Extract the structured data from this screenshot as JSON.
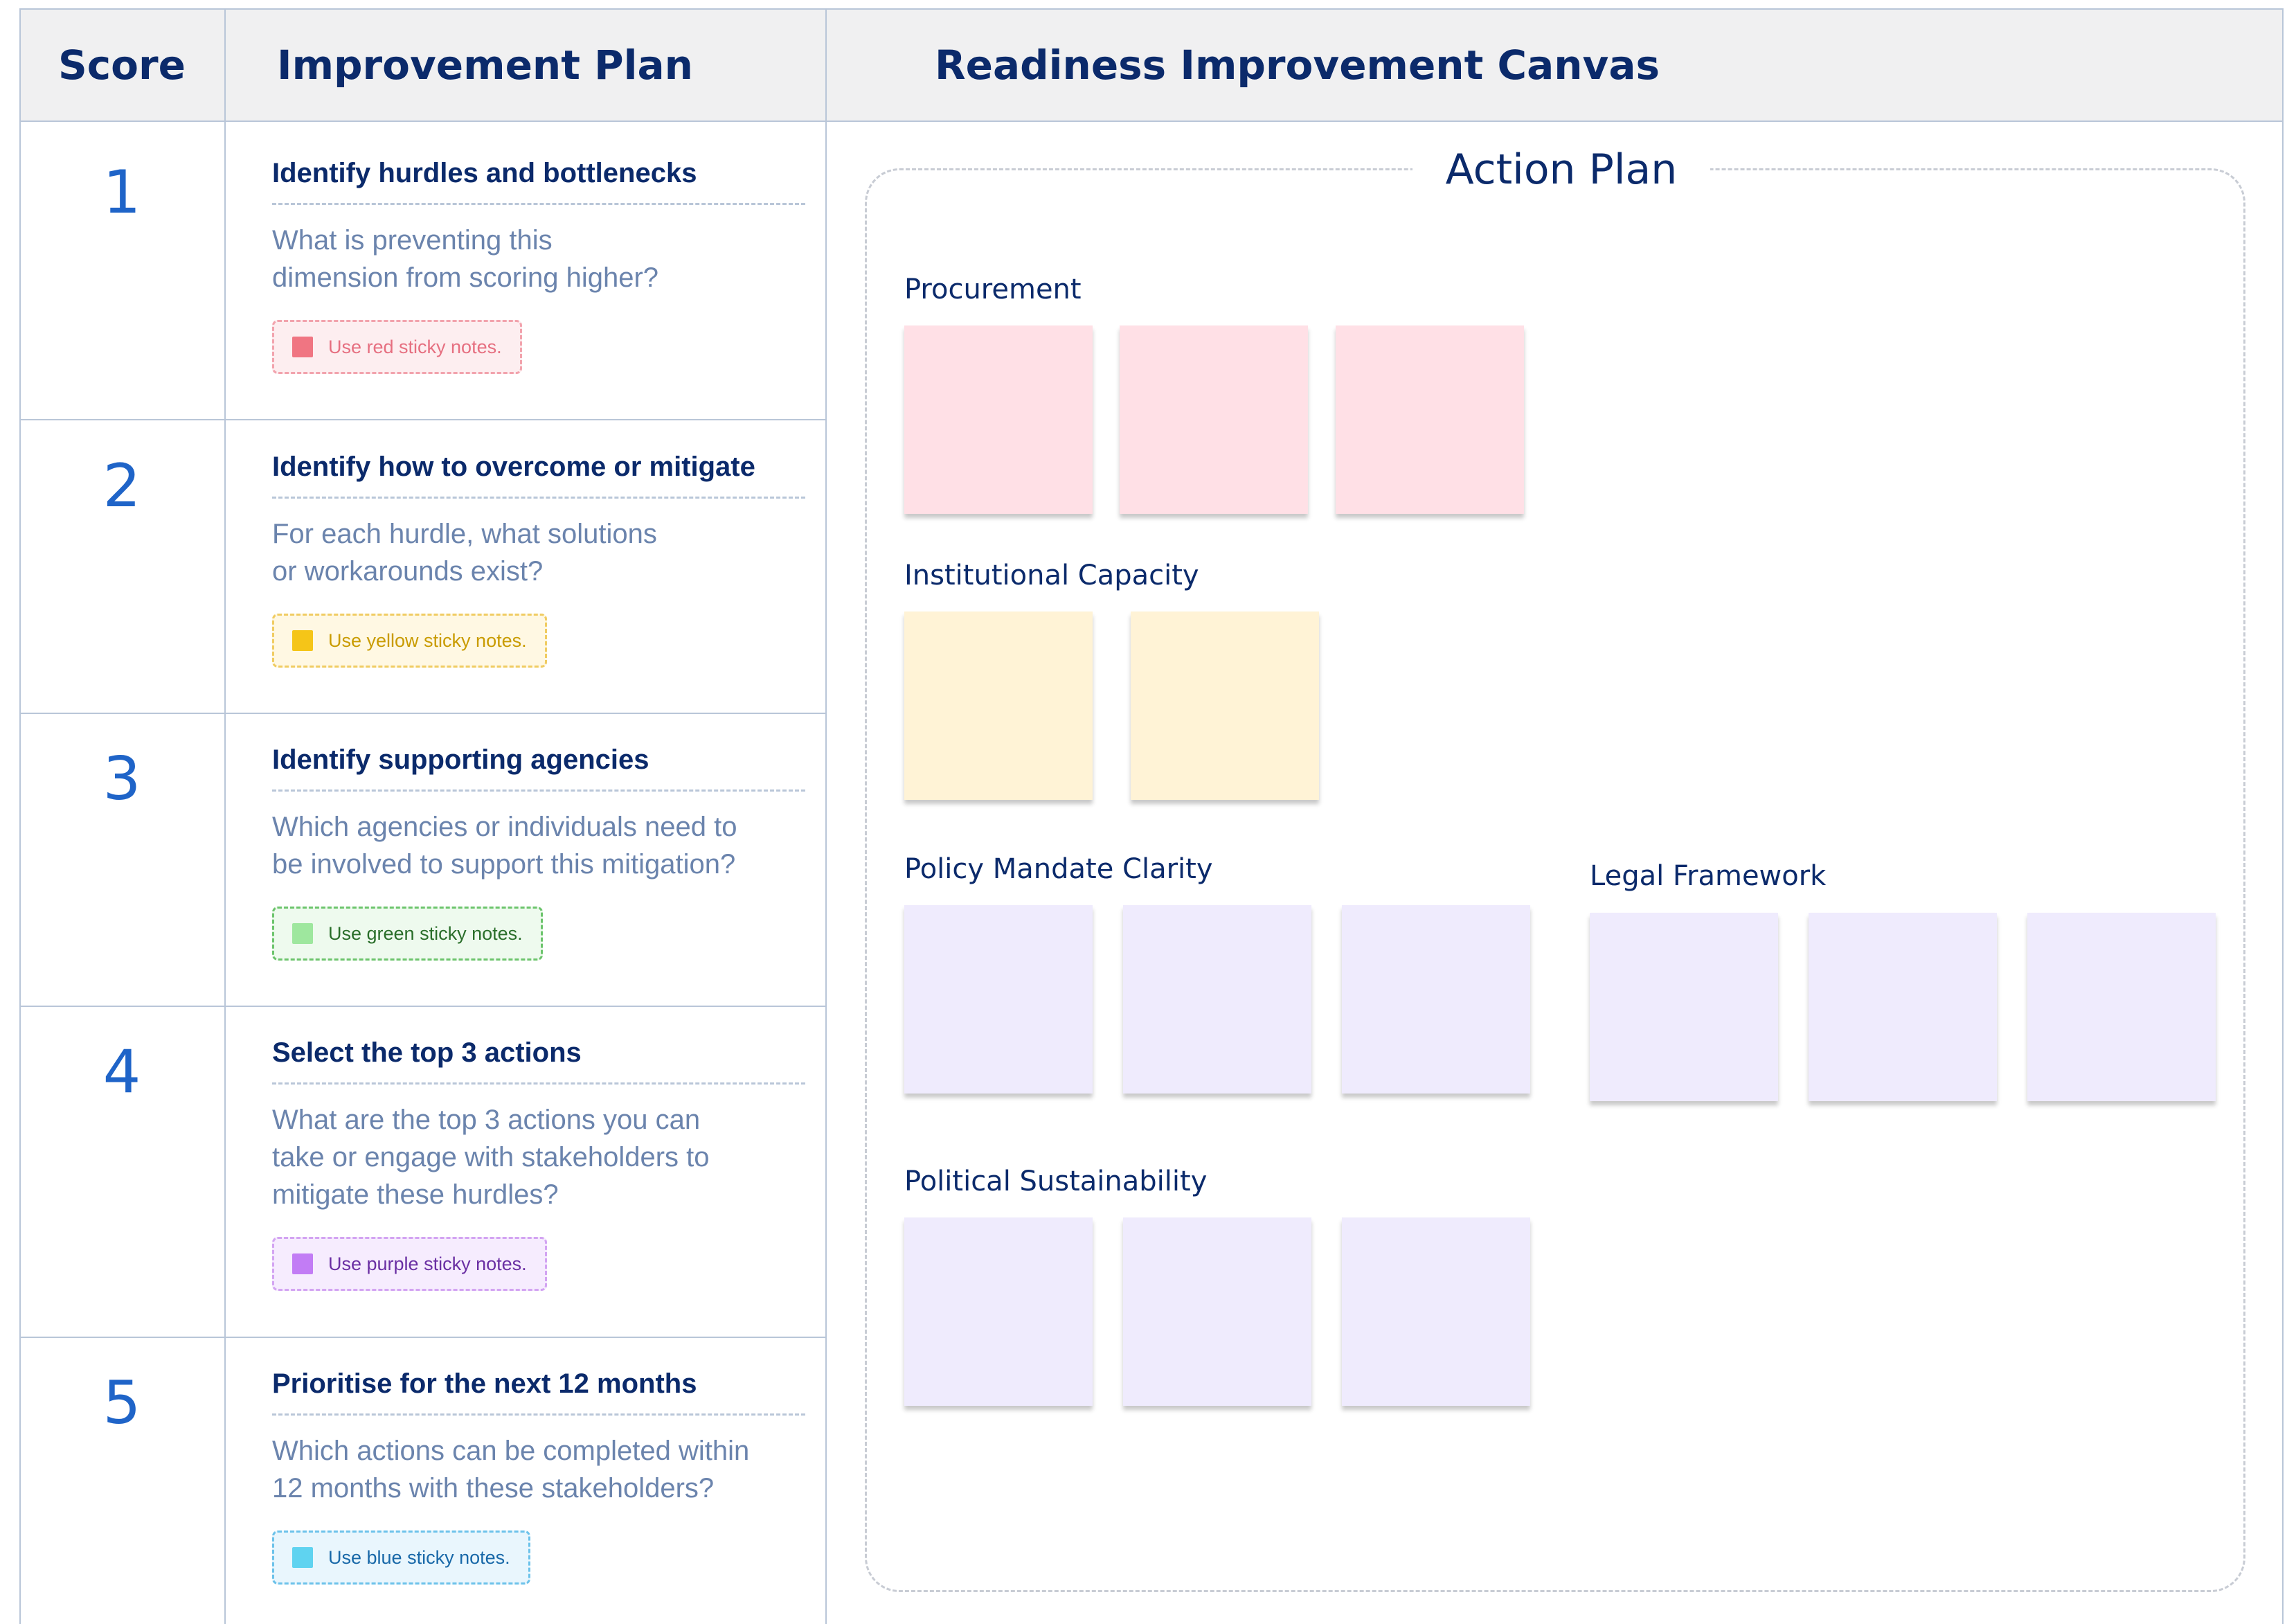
{
  "headers": {
    "score": "Score",
    "improvement_plan": "Improvement Plan",
    "canvas": "Readiness Improvement Canvas"
  },
  "steps": [
    {
      "score": "1",
      "title": "Identify hurdles and bottlenecks",
      "description": "What is preventing this\ndimension from scoring higher?",
      "hint": "Use red sticky notes.",
      "hint_color": "#f07582"
    },
    {
      "score": "2",
      "title": "Identify how to overcome or mitigate",
      "description": "For each hurdle, what solutions\nor workarounds exist?",
      "hint": "Use yellow sticky notes.",
      "hint_color": "#f5c518"
    },
    {
      "score": "3",
      "title": "Identify supporting agencies",
      "description": "Which agencies or individuals need to\nbe involved to support this mitigation?",
      "hint": "Use green sticky notes.",
      "hint_color": "#9ee79e"
    },
    {
      "score": "4",
      "title": "Select the top 3 actions",
      "description": "What are the top 3 actions you can\ntake or engage with stakeholders to\nmitigate these hurdles?",
      "hint": "Use purple sticky notes.",
      "hint_color": "#c27cf5"
    },
    {
      "score": "5",
      "title": "Prioritise for the next 12 months",
      "description": "Which actions can be completed within\n12 months with these stakeholders?",
      "hint": "Use blue sticky notes.",
      "hint_color": "#5fd3f0"
    }
  ],
  "canvas": {
    "title": "Action Plan",
    "groups": [
      {
        "label": "Procurement",
        "note_color": "#ffe0e6",
        "note_count": 3
      },
      {
        "label": "Institutional Capacity",
        "note_color": "#fff3d6",
        "note_count": 2
      },
      {
        "label": "Policy Mandate Clarity",
        "note_color": "#efebfd",
        "note_count": 3
      },
      {
        "label": "Legal Framework",
        "note_color": "#efebfd",
        "note_count": 3
      },
      {
        "label": "Political Sustainability",
        "note_color": "#efebfd",
        "note_count": 3
      }
    ]
  }
}
